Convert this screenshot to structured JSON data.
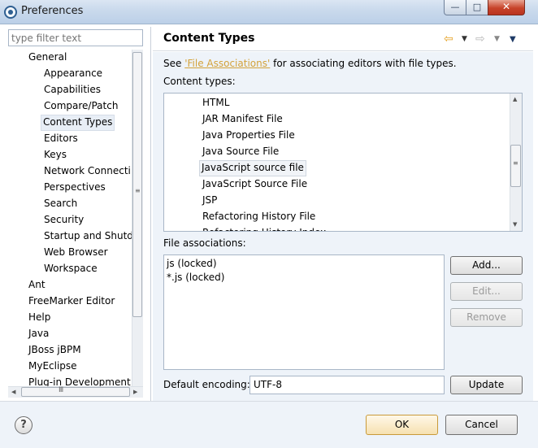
{
  "window": {
    "title": "Preferences",
    "min_glyph": "—",
    "max_glyph": "□",
    "close_glyph": "✕"
  },
  "sidebar": {
    "filter_placeholder": "type filter text",
    "items": [
      {
        "label": "General"
      },
      {
        "label": "Appearance"
      },
      {
        "label": "Capabilities"
      },
      {
        "label": "Compare/Patch"
      },
      {
        "label": "Content Types"
      },
      {
        "label": "Editors"
      },
      {
        "label": "Keys"
      },
      {
        "label": "Network Connecti"
      },
      {
        "label": "Perspectives"
      },
      {
        "label": "Search"
      },
      {
        "label": "Security"
      },
      {
        "label": "Startup and Shutd"
      },
      {
        "label": "Web Browser"
      },
      {
        "label": "Workspace"
      },
      {
        "label": "Ant"
      },
      {
        "label": "FreeMarker Editor"
      },
      {
        "label": "Help"
      },
      {
        "label": "Java"
      },
      {
        "label": "JBoss jBPM"
      },
      {
        "label": "MyEclipse"
      },
      {
        "label": "Plug-in Development"
      }
    ],
    "selected": "Content Types"
  },
  "page": {
    "title": "Content Types",
    "see_prefix": "See ",
    "see_link": "'File Associations'",
    "see_suffix": " for associating editors with file types.",
    "content_types_label": "Content types:",
    "content_types": [
      "HTML",
      "JAR Manifest File",
      "Java Properties File",
      "Java Source File",
      "JavaScript source file",
      "JavaScript Source File",
      "JSP",
      "Refactoring History File",
      "Refactoring History Index"
    ],
    "selected_content_type": "JavaScript source file",
    "file_assoc_label": "File associations:",
    "file_associations": [
      "js (locked)",
      "*.js (locked)"
    ],
    "add_label": "Add...",
    "edit_label": "Edit...",
    "remove_label": "Remove",
    "encoding_label": "Default encoding:",
    "encoding_value": "UTF-8",
    "update_label": "Update"
  },
  "footer": {
    "help_glyph": "?",
    "ok_label": "OK",
    "cancel_label": "Cancel"
  }
}
